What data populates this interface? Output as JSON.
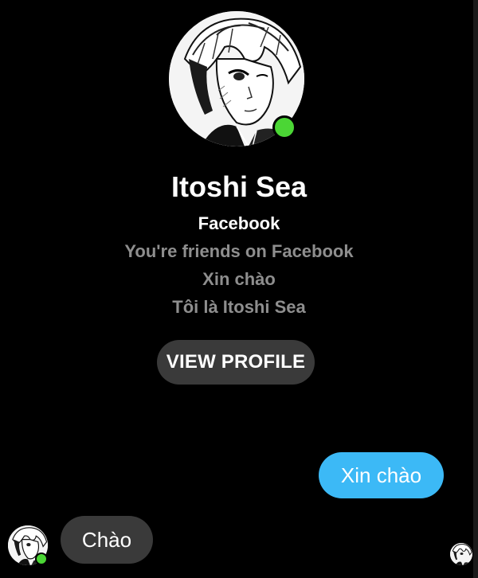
{
  "contact": {
    "name": "Itoshi Sea",
    "platform": "Facebook",
    "friend_status": "You're friends on Facebook",
    "bio_line_1": "Xin chào",
    "bio_line_2": "Tôi là Itoshi Sea",
    "online": true,
    "avatar_icon": "anime-portrait-avatar-icon"
  },
  "actions": {
    "view_profile_label": "VIEW PROFILE"
  },
  "messages": [
    {
      "direction": "outgoing",
      "text": "Xin chào"
    },
    {
      "direction": "incoming",
      "text": "Chào"
    }
  ],
  "colors": {
    "background": "#000000",
    "outgoing_bubble": "#3cb9f6",
    "incoming_bubble": "#3a3a3a",
    "online_indicator": "#4bd635",
    "muted_text": "#8e8e8e"
  }
}
